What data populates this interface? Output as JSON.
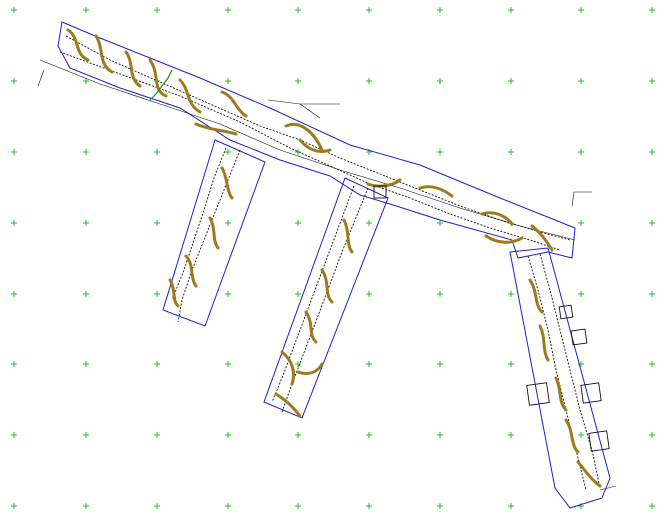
{
  "drawing": {
    "background": "#ffffff",
    "grid_marker_color": "#22c022",
    "boundary_color": "#1f1fd8",
    "feature_color": "#a07a1a",
    "linework_color": "#111111",
    "grid_icon": "plus-icon"
  }
}
